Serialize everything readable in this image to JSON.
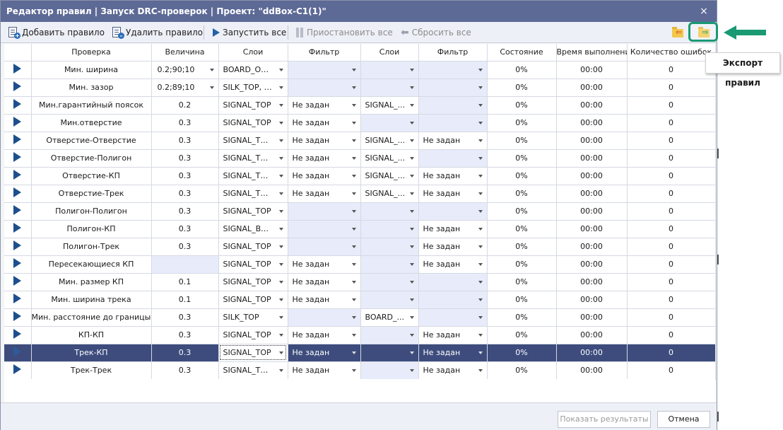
{
  "window": {
    "title": "Редактор правил | Запуск DRC-проверок | Проект: \"ddBox-C1(1)\"",
    "close_label": "×"
  },
  "toolbar": {
    "add_rule": "Добавить правило",
    "delete_rule": "Удалить правило",
    "run_all": "Запустить все",
    "pause_all": "Приостановить все",
    "reset_all": "Сбросить все"
  },
  "tooltip": {
    "export_rules": "Экспорт правил"
  },
  "table": {
    "columns": [
      "Проверка",
      "Величина",
      "Слои",
      "Фильтр",
      "Слои",
      "Фильтр",
      "Состояние",
      "Время выполнения",
      "Количество ошибок"
    ],
    "rows": [
      {
        "check": "Мин. ширина",
        "value": "0.2;90;10",
        "layers1": "BOARD_OUT...",
        "filter1": "",
        "layers2": "",
        "filter2": "",
        "state": "0%",
        "time": "00:00",
        "errors": "0"
      },
      {
        "check": "Мин. зазор",
        "value": "0.2;89;10",
        "layers1": "SILK_TOP, S...",
        "filter1": "",
        "layers2": "",
        "filter2": "",
        "state": "0%",
        "time": "00:00",
        "errors": "0"
      },
      {
        "check": "Мин.гарантийный поясок",
        "value": "0.2",
        "layers1": "SIGNAL_TOP",
        "filter1": "Не задан",
        "layers2": "SIGNAL_...",
        "filter2": "",
        "state": "0%",
        "time": "00:00",
        "errors": "0"
      },
      {
        "check": "Мин.отверстие",
        "value": "0.3",
        "layers1": "SIGNAL_TOP",
        "filter1": "Не задан",
        "layers2": "",
        "filter2": "",
        "state": "0%",
        "time": "00:00",
        "errors": "0"
      },
      {
        "check": "Отверстие-Отверстие",
        "value": "0.3",
        "layers1": "SIGNAL_TOP...",
        "filter1": "Не задан",
        "layers2": "SIGNAL_...",
        "filter2": "Не задан",
        "state": "0%",
        "time": "00:00",
        "errors": "0"
      },
      {
        "check": "Отверстие-Полигон",
        "value": "0.3",
        "layers1": "SIGNAL_TOP...",
        "filter1": "Не задан",
        "layers2": "SIGNAL_...",
        "filter2": "",
        "state": "0%",
        "time": "00:00",
        "errors": "0"
      },
      {
        "check": "Отверстие-КП",
        "value": "0.3",
        "layers1": "SIGNAL_TOP...",
        "filter1": "Не задан",
        "layers2": "SIGNAL_...",
        "filter2": "Не задан",
        "state": "0%",
        "time": "00:00",
        "errors": "0"
      },
      {
        "check": "Отверстие-Трек",
        "value": "0.3",
        "layers1": "SIGNAL_TOP...",
        "filter1": "Не задан",
        "layers2": "SIGNAL_...",
        "filter2": "Не задан",
        "state": "0%",
        "time": "00:00",
        "errors": "0"
      },
      {
        "check": "Полигон-Полигон",
        "value": "0.3",
        "layers1": "SIGNAL_TOP",
        "filter1": "",
        "layers2": "",
        "filter2": "",
        "state": "0%",
        "time": "00:00",
        "errors": "0"
      },
      {
        "check": "Полигон-КП",
        "value": "0.3",
        "layers1": "SIGNAL_BOT...",
        "filter1": "",
        "layers2": "",
        "filter2": "Не задан",
        "state": "0%",
        "time": "00:00",
        "errors": "0"
      },
      {
        "check": "Полигон-Трек",
        "value": "0.3",
        "layers1": "SIGNAL_TOP",
        "filter1": "",
        "layers2": "",
        "filter2": "Не задан",
        "state": "0%",
        "time": "00:00",
        "errors": "0"
      },
      {
        "check": "Пересекающиеся КП",
        "value": "",
        "layers1": "SIGNAL_TOP",
        "filter1": "Не задан",
        "layers2": "",
        "filter2": "Не задан",
        "state": "0%",
        "time": "00:00",
        "errors": "0"
      },
      {
        "check": "Мин. размер КП",
        "value": "0.1",
        "layers1": "SIGNAL_TOP",
        "filter1": "Не задан",
        "layers2": "",
        "filter2": "",
        "state": "0%",
        "time": "00:00",
        "errors": "0"
      },
      {
        "check": "Мин. ширина трека",
        "value": "0.1",
        "layers1": "SIGNAL_TOP",
        "filter1": "Не задан",
        "layers2": "",
        "filter2": "",
        "state": "0%",
        "time": "00:00",
        "errors": "0"
      },
      {
        "check": "Мин. расстояние до границы...",
        "value": "0.3",
        "layers1": "SILK_TOP",
        "filter1": "",
        "layers2": "BOARD_...",
        "filter2": "",
        "state": "0%",
        "time": "00:00",
        "errors": "0"
      },
      {
        "check": "КП-КП",
        "value": "0.3",
        "layers1": "SIGNAL_TOP",
        "filter1": "Не задан",
        "layers2": "",
        "filter2": "Не задан",
        "state": "0%",
        "time": "00:00",
        "errors": "0"
      },
      {
        "check": "Трек-КП",
        "value": "0.3",
        "layers1": "SIGNAL_TOP",
        "filter1": "Не задан",
        "layers2": "",
        "filter2": "Не задан",
        "state": "0%",
        "time": "00:00",
        "errors": "0",
        "selected": true
      },
      {
        "check": "Трек-Трек",
        "value": "0.3",
        "layers1": "SIGNAL_TOP...",
        "filter1": "Не задан",
        "layers2": "",
        "filter2": "Не задан",
        "state": "0%",
        "time": "00:00",
        "errors": "0"
      }
    ]
  },
  "footer": {
    "show_results": "Показать результаты",
    "cancel": "Отмена"
  },
  "colors": {
    "titlebar": "#5d6a96",
    "selected_row": "#3d4c7d",
    "highlight": "#1a9a73",
    "row_play": "#1d4f8c"
  }
}
